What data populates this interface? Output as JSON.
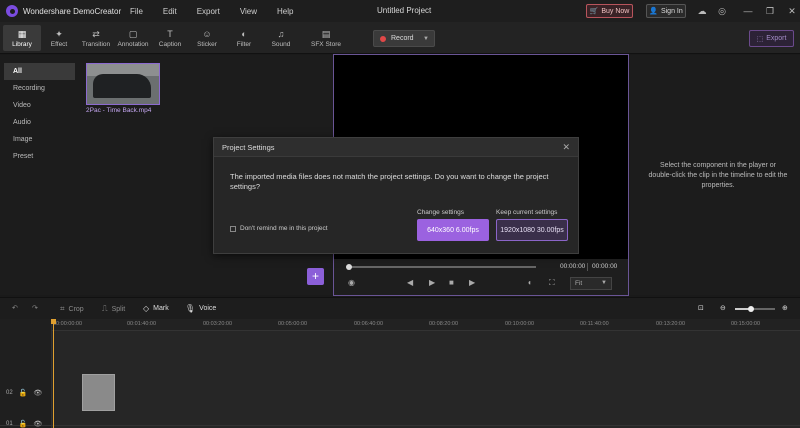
{
  "app": {
    "name": "Wondershare DemoCreator",
    "document_title": "Untitled Project",
    "menu": [
      "File",
      "Edit",
      "Export",
      "View",
      "Help"
    ],
    "buy_now": "Buy Now",
    "sign_in": "Sign In"
  },
  "toolbar": {
    "tools": [
      {
        "label": "Library",
        "icon": "library-icon"
      },
      {
        "label": "Effect",
        "icon": "effect-icon"
      },
      {
        "label": "Transition",
        "icon": "transition-icon"
      },
      {
        "label": "Annotation",
        "icon": "annotation-icon"
      },
      {
        "label": "Caption",
        "icon": "caption-icon"
      },
      {
        "label": "Sticker",
        "icon": "sticker-icon"
      },
      {
        "label": "Filter",
        "icon": "filter-icon"
      },
      {
        "label": "Sound",
        "icon": "sound-icon"
      },
      {
        "label": "SFX Store",
        "icon": "sfx-store-icon"
      }
    ],
    "record_label": "Record",
    "export_label": "Export"
  },
  "sidebar": {
    "items": [
      "All",
      "Recording",
      "Video",
      "Audio",
      "Image",
      "Preset"
    ],
    "active": "All"
  },
  "media": {
    "clip_name": "2Pac - Time Back.mp4"
  },
  "player": {
    "time_current": "00:00:00",
    "time_total": "00:00:00",
    "fit_label": "Fit"
  },
  "properties": {
    "hint": "Select the component in the player or double-click the clip in the timeline to edit the properties."
  },
  "dialog": {
    "title": "Project Settings",
    "message": "The imported media files does not match the project settings. Do you want to change the project settings?",
    "checkbox_label": "Don't remind me in this project",
    "change_label": "Change settings",
    "change_value": "640x360 6.00fps",
    "keep_label": "Keep current settings",
    "keep_value": "1920x1080 30.00fps"
  },
  "timeline": {
    "tools": [
      "Crop",
      "Split",
      "Mark",
      "Voice"
    ],
    "ruler": [
      "00:00:00:00",
      "00:01:40:00",
      "00:03:20:00",
      "00:05:00:00",
      "00:06:40:00",
      "00:08:20:00",
      "00:10:00:00",
      "00:11:40:00",
      "00:13:20:00",
      "00:15:00:00"
    ],
    "tracks": [
      "02",
      "01"
    ]
  },
  "colors": {
    "accent": "#9b62e0",
    "buy_border": "#b8545c",
    "record_dot": "#e04848",
    "playhead": "#e0a030"
  }
}
